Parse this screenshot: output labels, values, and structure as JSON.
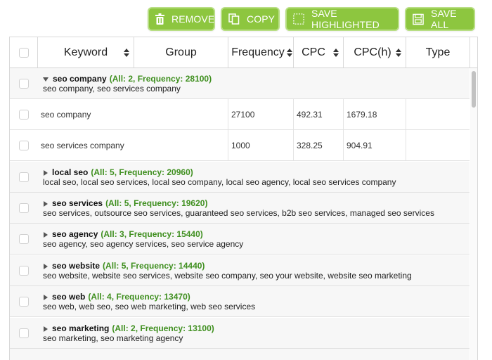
{
  "toolbar": {
    "remove_label": "REMOVE",
    "copy_label": "COPY",
    "save_highlighted_label": "SAVE HIGHLIGHTED",
    "save_all_label": "SAVE ALL"
  },
  "colors": {
    "accent": "#8dc63f",
    "stats_green": "#3f8f1f"
  },
  "columns": {
    "keyword": "Keyword",
    "group": "Group",
    "frequency": "Frequency",
    "cpc": "CPC",
    "cpch": "CPC(h)",
    "type": "Type"
  },
  "groups": [
    {
      "name": "seo company",
      "stats": "(All: 2, Frequency: 28100)",
      "keywords": "seo company, seo services company",
      "expanded": true,
      "rows": [
        {
          "keyword": "seo company",
          "frequency": "27100",
          "cpc": "492.31",
          "cpch": "1679.18"
        },
        {
          "keyword": "seo services company",
          "frequency": "1000",
          "cpc": "328.25",
          "cpch": "904.91"
        }
      ]
    },
    {
      "name": "local seo",
      "stats": "(All: 5, Frequency: 20960)",
      "keywords": "local seo, local seo services, local seo company, local seo agency, local seo services company",
      "expanded": false
    },
    {
      "name": "seo services",
      "stats": "(All: 5, Frequency: 19620)",
      "keywords": "seo services, outsource seo services, guaranteed seo services, b2b seo services, managed seo services",
      "expanded": false
    },
    {
      "name": "seo agency",
      "stats": "(All: 3, Frequency: 15440)",
      "keywords": "seo agency, seo agency services, seo service agency",
      "expanded": false
    },
    {
      "name": "seo website",
      "stats": "(All: 5, Frequency: 14440)",
      "keywords": "seo website, website seo services, website seo company, seo your website, website seo marketing",
      "expanded": false
    },
    {
      "name": "seo web",
      "stats": "(All: 4, Frequency: 13470)",
      "keywords": "seo web, web seo, seo web marketing, web seo services",
      "expanded": false
    },
    {
      "name": "seo marketing",
      "stats": "(All: 2, Frequency: 13100)",
      "keywords": "seo marketing, seo marketing agency",
      "expanded": false
    }
  ]
}
